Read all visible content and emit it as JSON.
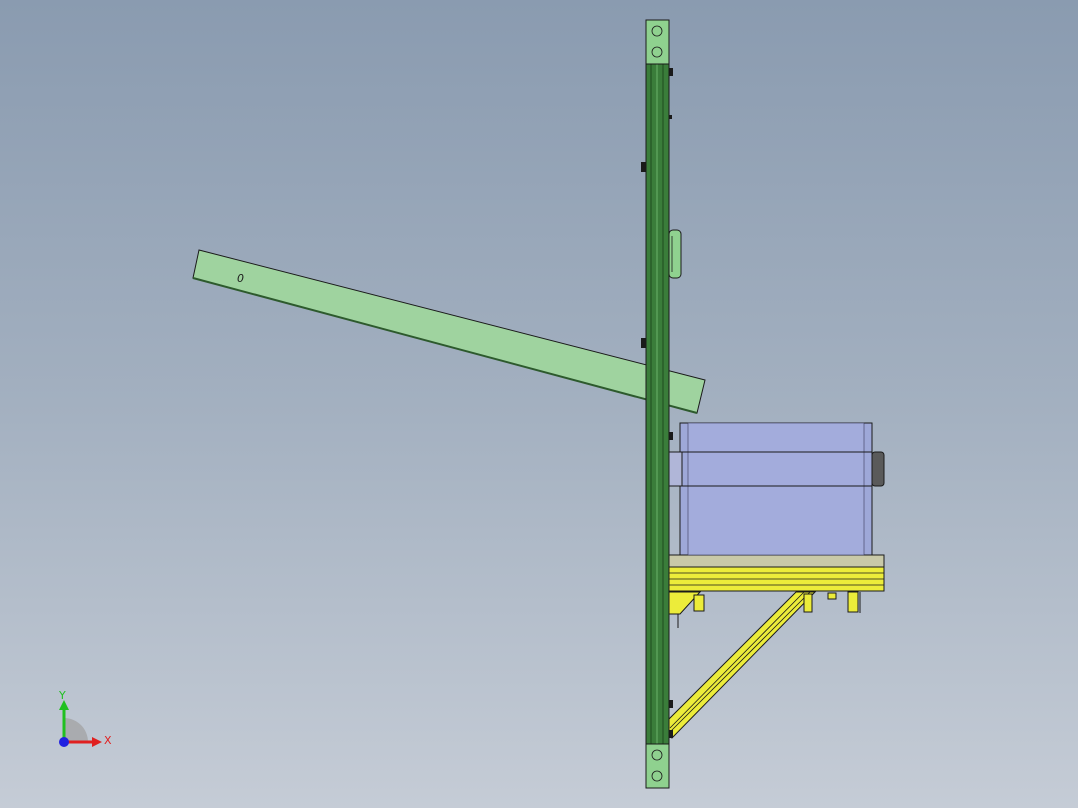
{
  "viewport": {
    "background_top": "#8a9bb0",
    "background_bottom": "#c5ccd6"
  },
  "model": {
    "colors": {
      "frame_green": "#3a7d3a",
      "frame_green_light": "#8fd18f",
      "arm_green": "#9fd39f",
      "box_blue": "#9ea8d8",
      "bracket_yellow": "#ecec3a",
      "outline": "#1a1a1a"
    },
    "arm_label": "0"
  },
  "triad": {
    "x_label": "X",
    "y_label": "Y",
    "x_color": "#e02020",
    "y_color": "#20c020",
    "z_color": "#2020e0"
  }
}
